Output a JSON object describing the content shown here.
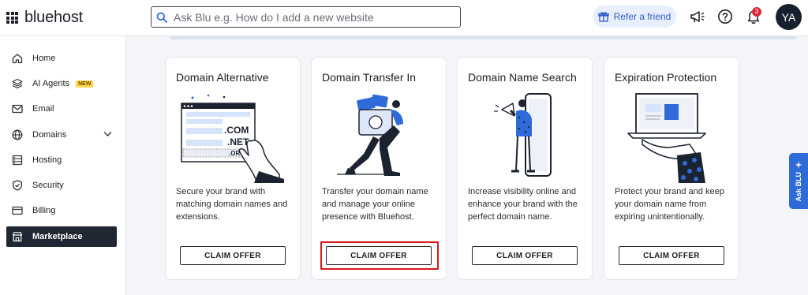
{
  "header": {
    "logo_text": "bluehost",
    "search_placeholder": "Ask Blu e.g. How do I add a new website",
    "refer_label": "Refer a friend",
    "notification_count": "3",
    "avatar_initials": "YA"
  },
  "sidebar": {
    "items": [
      {
        "label": "Home",
        "icon": "home-icon"
      },
      {
        "label": "AI Agents",
        "icon": "layers-icon",
        "badge": "NEW"
      },
      {
        "label": "Email",
        "icon": "mail-icon"
      },
      {
        "label": "Domains",
        "icon": "globe-icon"
      },
      {
        "label": "Hosting",
        "icon": "server-icon"
      },
      {
        "label": "Security",
        "icon": "shield-icon"
      },
      {
        "label": "Billing",
        "icon": "billing-icon"
      },
      {
        "label": "Marketplace",
        "icon": "store-icon",
        "active": true
      }
    ]
  },
  "cards": [
    {
      "title": "Domain Alternative",
      "description": "Secure your brand with matching domain names and extensions.",
      "button": "CLAIM OFFER",
      "illustration": {
        "tld1": ".COM",
        "tld2": ".NET",
        "tld3": ".ORG"
      }
    },
    {
      "title": "Domain Transfer In",
      "description": "Transfer your domain name and manage your online presence with Bluehost.",
      "button": "CLAIM OFFER"
    },
    {
      "title": "Domain Name Search",
      "description": "Increase visibility online and enhance your brand with the perfect domain name.",
      "button": "CLAIM OFFER"
    },
    {
      "title": "Expiration Protection",
      "description": "Protect your brand and keep your domain name from expiring unintentionally.",
      "button": "CLAIM OFFER"
    }
  ],
  "ask_blu_label": "Ask BLU",
  "colors": {
    "accent": "#2f6ad9",
    "sidebar_active": "#202733",
    "highlight": "#d71a1a",
    "notification": "#d9283a"
  }
}
